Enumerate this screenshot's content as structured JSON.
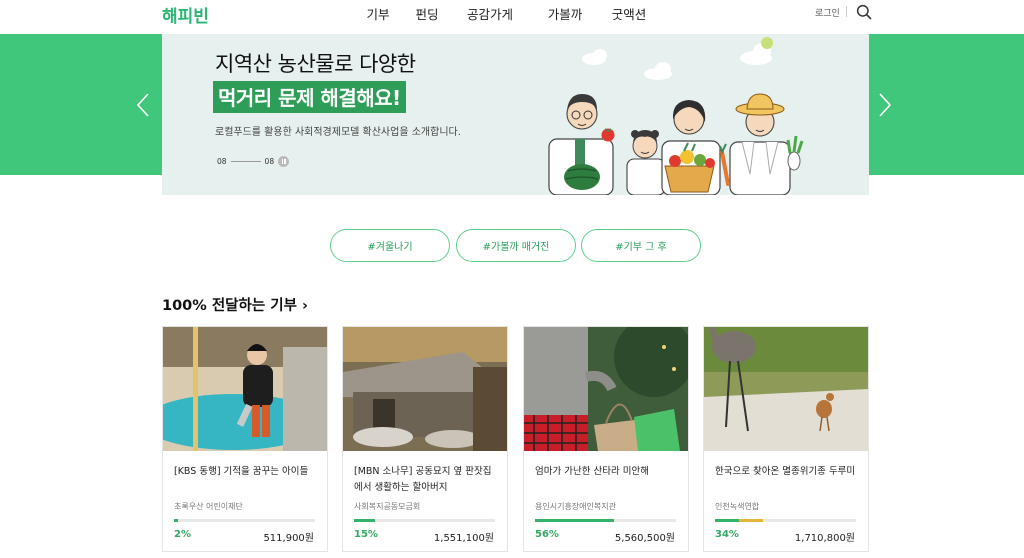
{
  "header": {
    "logo": "해피빈",
    "nav": [
      "기부",
      "펀딩",
      "공감가게",
      "가볼까",
      "굿액션"
    ],
    "login": "로그인"
  },
  "banner": {
    "title": "지역산 농산물로 다양한",
    "highlight": "먹거리 문제 해결해요!",
    "subtitle": "로컬푸드를 활용한 사회적경제모델 확산사업을 소개합니다.",
    "page_current": "08",
    "page_total": "08"
  },
  "tags": [
    "#겨울나기",
    "#가볼까 매거진",
    "#기부 그 후"
  ],
  "section": {
    "title": "100% 전달하는 기부 ›"
  },
  "cards": [
    {
      "title": "[KBS 동행] 기적을 꿈꾸는 아이들",
      "org": "초록우산 어린이재단",
      "progress": 0.02,
      "percent": "2%",
      "amount": "511,900원"
    },
    {
      "title": "[MBN 소나무] 공동묘지 옆 판잣집에서 생활하는 할아버지",
      "org": "사회복지공동모금회",
      "progress": 0.15,
      "percent": "15%",
      "amount": "1,551,100원"
    },
    {
      "title": "엄마가 가난한 산타라 미안해",
      "org": "용인시기흥장애인복지관",
      "progress": 0.56,
      "percent": "56%",
      "amount": "5,560,500원"
    },
    {
      "title": "한국으로 찾아온 멸종위기종 두루미",
      "org": "인천녹색연합",
      "progress": 0.34,
      "percent": "34%",
      "amount": "1,710,800원"
    }
  ],
  "colors": {
    "brand": "#2bb673",
    "band": "#40c77c",
    "highlight": "#2e9d58",
    "progress": "#34b36c",
    "progress_accent": "#e7b53a"
  }
}
